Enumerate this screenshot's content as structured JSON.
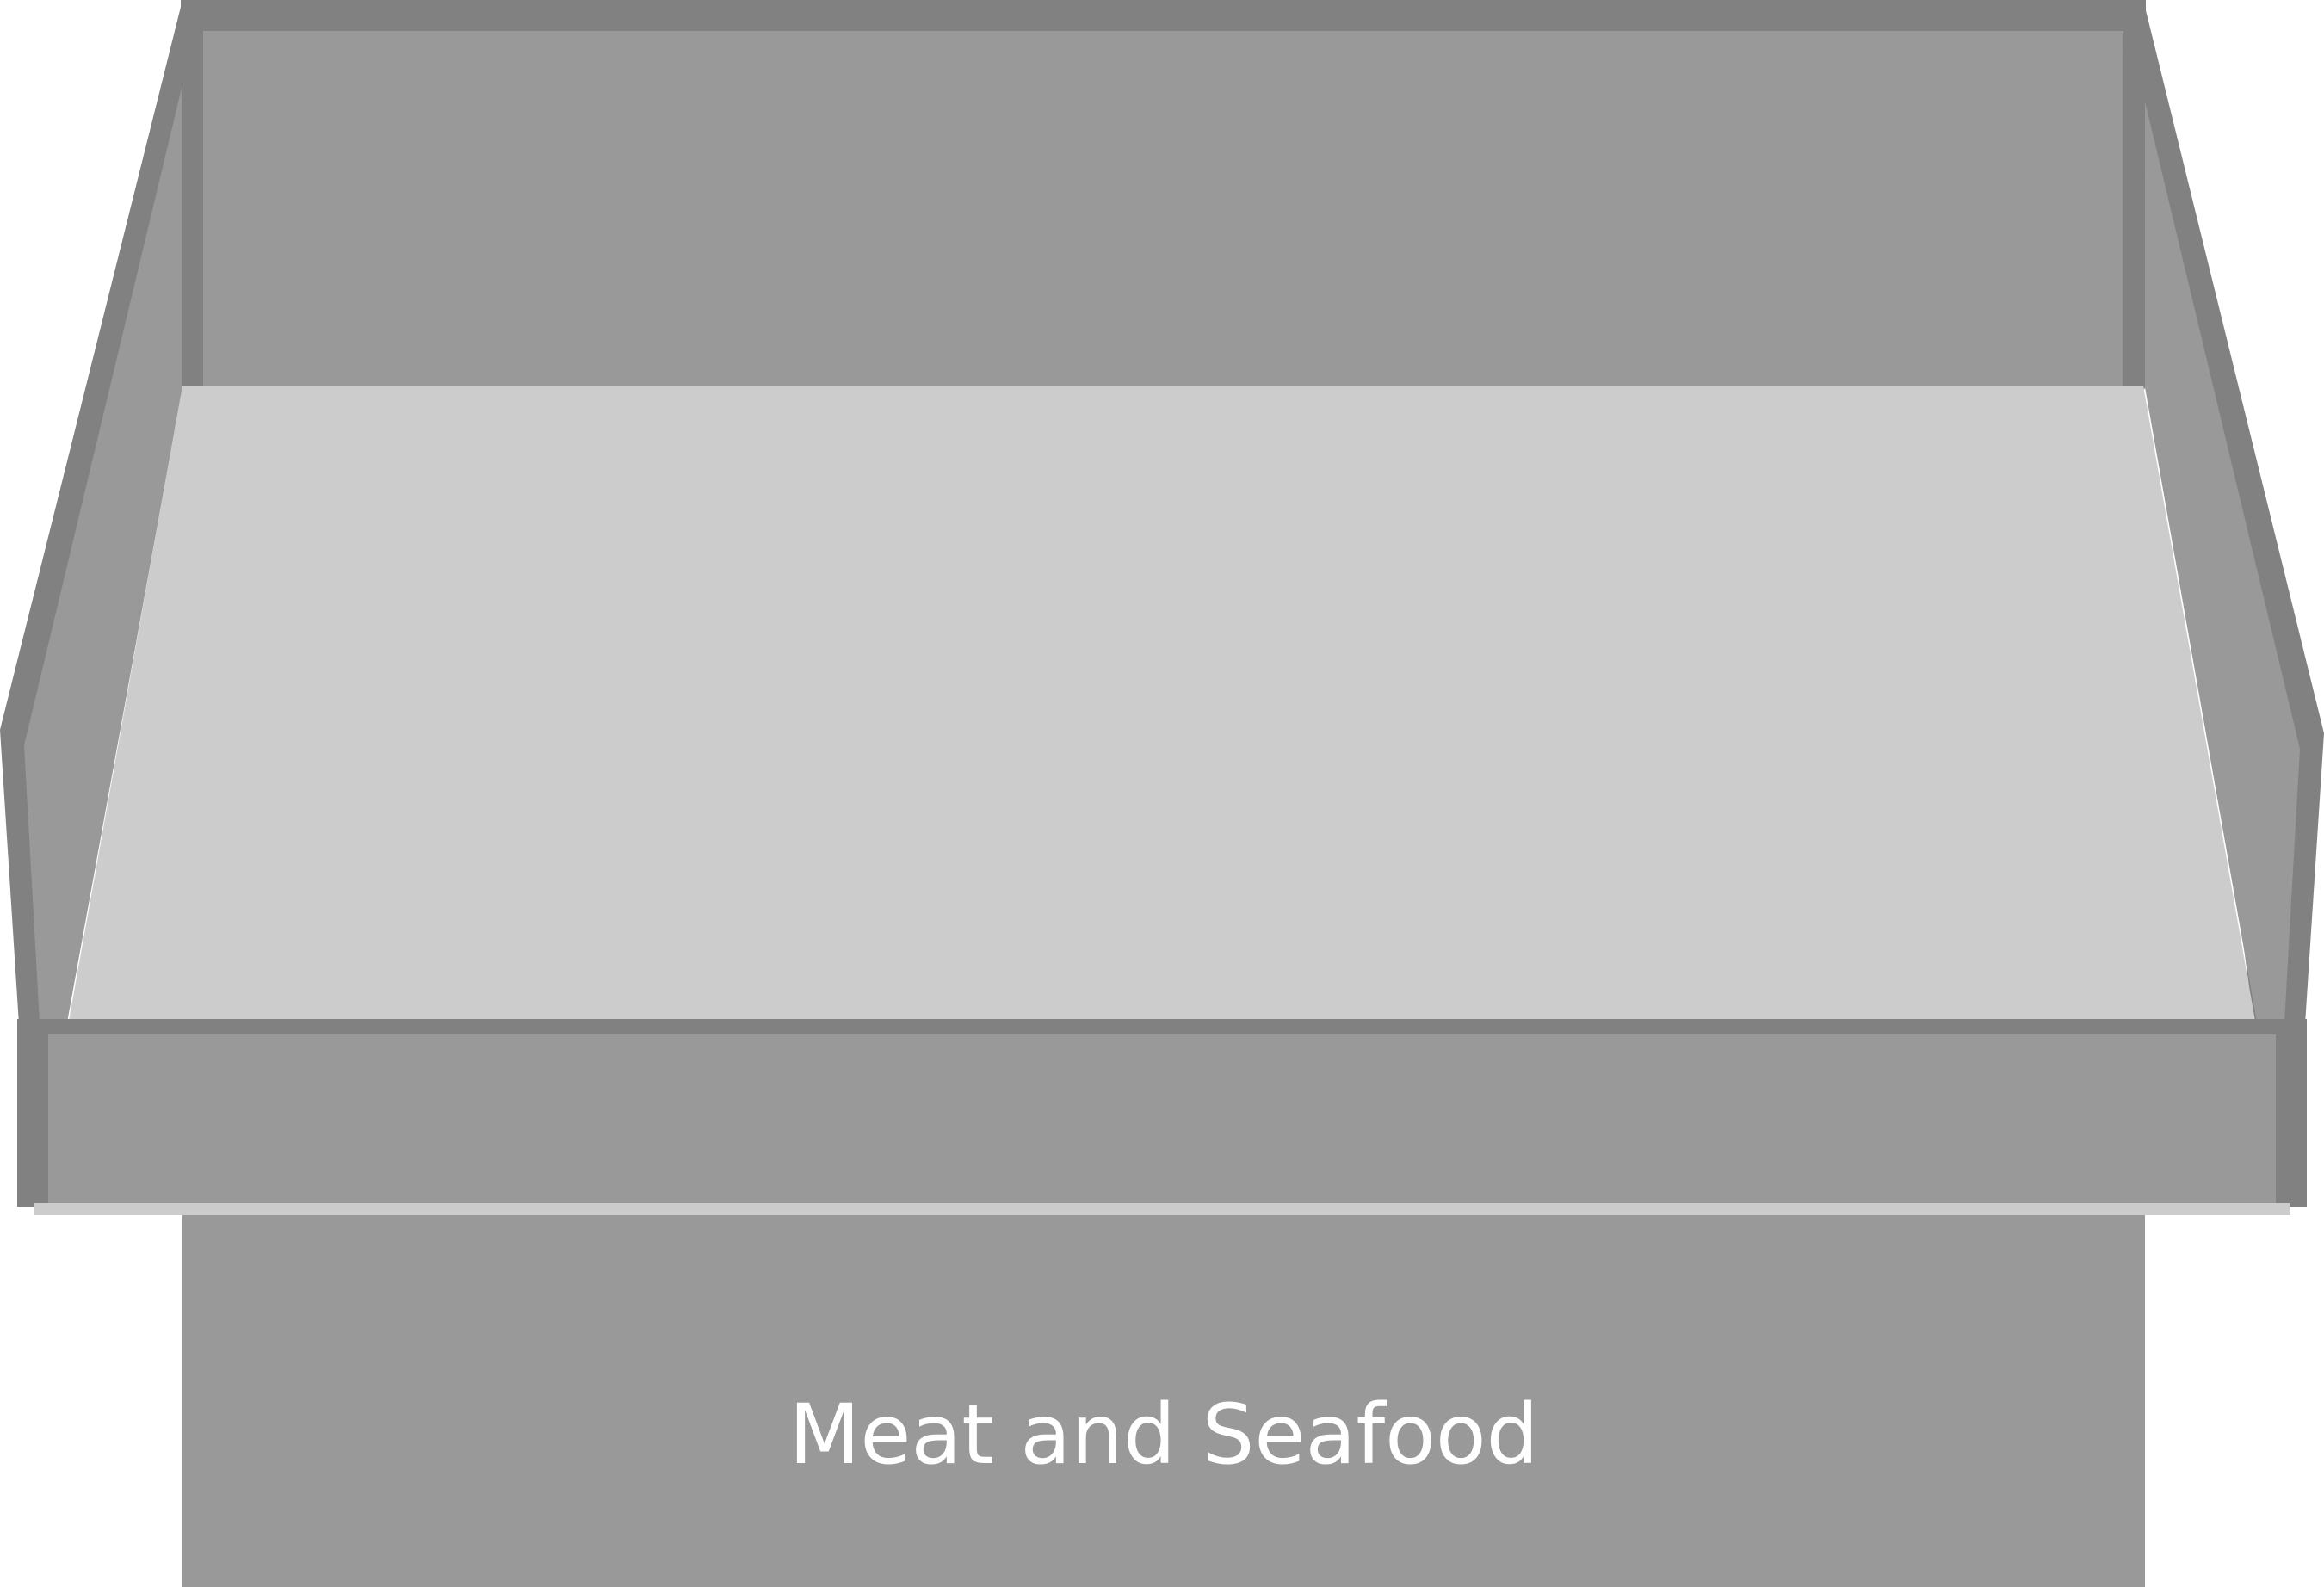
{
  "display_case": {
    "label": "Meat and Seafood",
    "colors": {
      "panel": "#999999",
      "trim": "#818181",
      "floor": "#cccccc",
      "label_text": "#ffffff",
      "background": "#ffffff"
    }
  }
}
